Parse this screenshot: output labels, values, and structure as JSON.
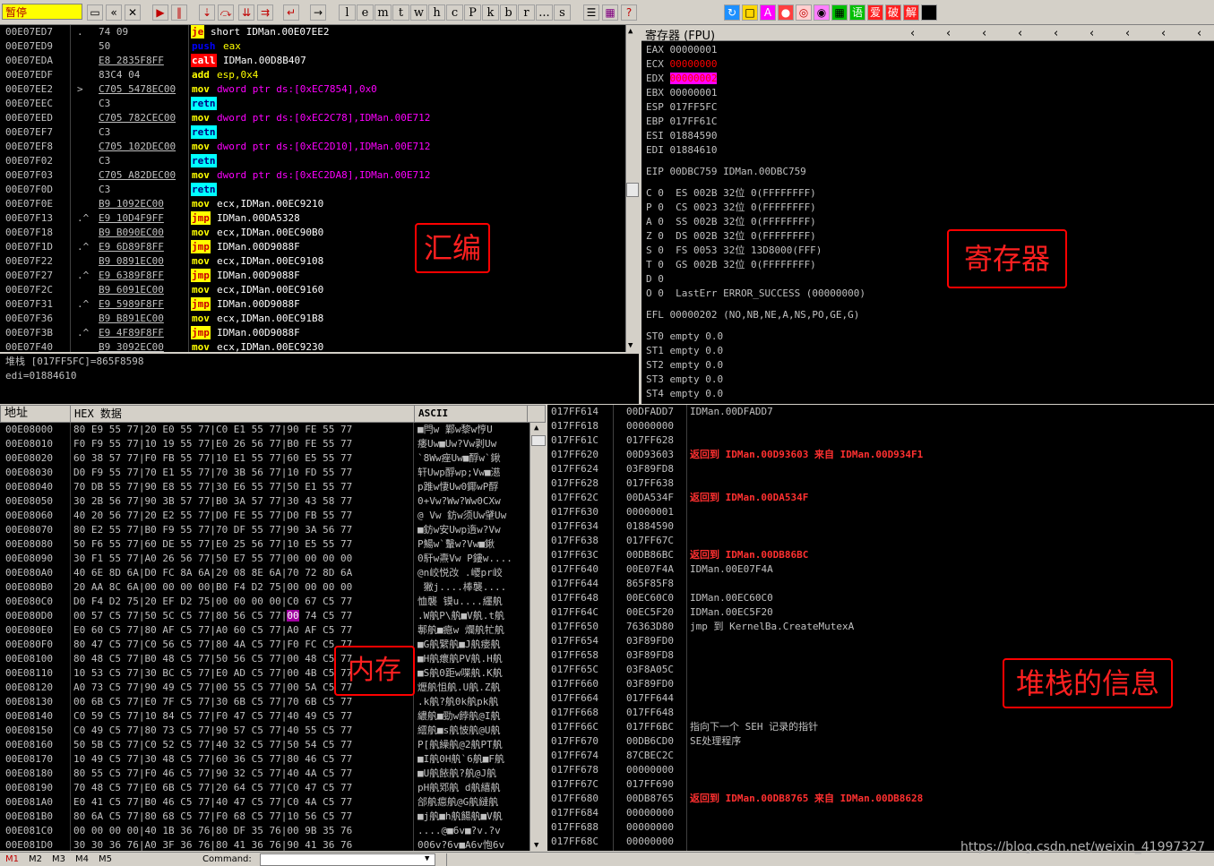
{
  "toolbar": {
    "status": "暂停",
    "letters": [
      "l",
      "e",
      "m",
      "t",
      "w",
      "h",
      "c",
      "P",
      "k",
      "b",
      "r",
      "...",
      "s"
    ],
    "right_icons": [
      "refresh",
      "A",
      "record",
      "target",
      "scope",
      "grid",
      "语",
      "爱",
      "破",
      "解"
    ]
  },
  "cpu": {
    "rows": [
      {
        "addr": "00E07ED7",
        "mark": ".",
        "hex": "74 09",
        "mn": "je",
        "ops": "short IDMan.00E07EE2",
        "mc": "m-je",
        "oc": "ops-w"
      },
      {
        "addr": "00E07ED9",
        "mark": "",
        "hex": "50",
        "mn": "push",
        "ops": "eax",
        "mc": "m-push",
        "oc": "ops-y"
      },
      {
        "addr": "00E07EDA",
        "mark": "",
        "hex": "E8 2835F8FF",
        "mn": "call",
        "ops": "IDMan.00D8B407",
        "mc": "m-call",
        "oc": "ops-w"
      },
      {
        "addr": "00E07EDF",
        "mark": "",
        "hex": "83C4 04",
        "mn": "add",
        "ops": "esp,0x4",
        "mc": "m-add",
        "oc": "ops-y"
      },
      {
        "addr": "00E07EE2",
        "mark": ">",
        "hex": "C705 5478EC00",
        "mn": "mov",
        "ops": "dword ptr ds:[0xEC7854],0x0",
        "mc": "m-mov",
        "oc": "ops-m"
      },
      {
        "addr": "00E07EEC",
        "mark": "",
        "hex": "C3",
        "mn": "retn",
        "ops": "",
        "mc": "m-retn",
        "oc": "ops-w"
      },
      {
        "addr": "00E07EED",
        "mark": "",
        "hex": "C705 782CEC00",
        "mn": "mov",
        "ops": "dword ptr ds:[0xEC2C78],IDMan.00E712",
        "mc": "m-mov",
        "oc": "ops-m"
      },
      {
        "addr": "00E07EF7",
        "mark": "",
        "hex": "C3",
        "mn": "retn",
        "ops": "",
        "mc": "m-retn",
        "oc": "ops-w"
      },
      {
        "addr": "00E07EF8",
        "mark": "",
        "hex": "C705 102DEC00",
        "mn": "mov",
        "ops": "dword ptr ds:[0xEC2D10],IDMan.00E712",
        "mc": "m-mov",
        "oc": "ops-m"
      },
      {
        "addr": "00E07F02",
        "mark": "",
        "hex": "C3",
        "mn": "retn",
        "ops": "",
        "mc": "m-retn",
        "oc": "ops-w"
      },
      {
        "addr": "00E07F03",
        "mark": "",
        "hex": "C705 A82DEC00",
        "mn": "mov",
        "ops": "dword ptr ds:[0xEC2DA8],IDMan.00E712",
        "mc": "m-mov",
        "oc": "ops-m"
      },
      {
        "addr": "00E07F0D",
        "mark": "",
        "hex": "C3",
        "mn": "retn",
        "ops": "",
        "mc": "m-retn",
        "oc": "ops-w"
      },
      {
        "addr": "00E07F0E",
        "mark": "",
        "hex": "B9 1092EC00",
        "mn": "mov",
        "ops": "ecx,IDMan.00EC9210",
        "mc": "m-mov",
        "oc": "ops-w"
      },
      {
        "addr": "00E07F13",
        "mark": ".^",
        "hex": "E9 10D4F9FF",
        "mn": "jmp",
        "ops": "IDMan.00DA5328",
        "mc": "m-jmp",
        "oc": "ops-w"
      },
      {
        "addr": "00E07F18",
        "mark": "",
        "hex": "B9 B090EC00",
        "mn": "mov",
        "ops": "ecx,IDMan.00EC90B0",
        "mc": "m-mov",
        "oc": "ops-w"
      },
      {
        "addr": "00E07F1D",
        "mark": ".^",
        "hex": "E9 6D89F8FF",
        "mn": "jmp",
        "ops": "IDMan.00D9088F",
        "mc": "m-jmp",
        "oc": "ops-w"
      },
      {
        "addr": "00E07F22",
        "mark": "",
        "hex": "B9 0891EC00",
        "mn": "mov",
        "ops": "ecx,IDMan.00EC9108",
        "mc": "m-mov",
        "oc": "ops-w"
      },
      {
        "addr": "00E07F27",
        "mark": ".^",
        "hex": "E9 6389F8FF",
        "mn": "jmp",
        "ops": "IDMan.00D9088F",
        "mc": "m-jmp",
        "oc": "ops-w"
      },
      {
        "addr": "00E07F2C",
        "mark": "",
        "hex": "B9 6091EC00",
        "mn": "mov",
        "ops": "ecx,IDMan.00EC9160",
        "mc": "m-mov",
        "oc": "ops-w"
      },
      {
        "addr": "00E07F31",
        "mark": ".^",
        "hex": "E9 5989F8FF",
        "mn": "jmp",
        "ops": "IDMan.00D9088F",
        "mc": "m-jmp",
        "oc": "ops-w"
      },
      {
        "addr": "00E07F36",
        "mark": "",
        "hex": "B9 B891EC00",
        "mn": "mov",
        "ops": "ecx,IDMan.00EC91B8",
        "mc": "m-mov",
        "oc": "ops-w"
      },
      {
        "addr": "00E07F3B",
        "mark": ".^",
        "hex": "E9 4F89F8FF",
        "mn": "jmp",
        "ops": "IDMan.00D9088F",
        "mc": "m-jmp",
        "oc": "ops-w"
      },
      {
        "addr": "00E07F40",
        "mark": "",
        "hex": "B9 3092EC00",
        "mn": "mov",
        "ops": "ecx,IDMan.00EC9230",
        "mc": "m-mov",
        "oc": "ops-w"
      }
    ]
  },
  "info": {
    "line1": "堆栈 [017FF5FC]=865F8598",
    "line2": "edi=01884610"
  },
  "registers": {
    "title": "寄存器 (FPU)",
    "gp": [
      {
        "name": "EAX",
        "val": "00000001",
        "cls": ""
      },
      {
        "name": "ECX",
        "val": "00000000",
        "cls": "regred"
      },
      {
        "name": "EDX",
        "val": "00000002",
        "cls": "reghl"
      },
      {
        "name": "EBX",
        "val": "00000001",
        "cls": ""
      },
      {
        "name": "ESP",
        "val": "017FF5FC",
        "cls": ""
      },
      {
        "name": "EBP",
        "val": "017FF61C",
        "cls": ""
      },
      {
        "name": "ESI",
        "val": "01884590",
        "cls": ""
      },
      {
        "name": "EDI",
        "val": "01884610",
        "cls": ""
      }
    ],
    "eip": "EIP 00DBC759 IDMan.00DBC759",
    "flags": [
      "C 0  ES 002B 32位 0(FFFFFFFF)",
      "P 0  CS 0023 32位 0(FFFFFFFF)",
      "A 0  SS 002B 32位 0(FFFFFFFF)",
      "Z 0  DS 002B 32位 0(FFFFFFFF)",
      "S 0  FS 0053 32位 13D8000(FFF)",
      "T 0  GS 002B 32位 0(FFFFFFFF)",
      "D 0",
      "O 0  LastErr ERROR_SUCCESS (00000000)"
    ],
    "efl": "EFL 00000202 (NO,NB,NE,A,NS,PO,GE,G)",
    "fpu": [
      "ST0 empty 0.0",
      "ST1 empty 0.0",
      "ST2 empty 0.0",
      "ST3 empty 0.0",
      "ST4 empty 0.0"
    ]
  },
  "dump": {
    "col_addr": "地址",
    "col_hex": "HEX 数据",
    "col_ascii": "ASCII",
    "rows": [
      [
        "00E08000",
        "80 E9 55 77|20 E0 55 77|C0 E1 55 77|90 FE 55 77",
        "■閂w 鄴w黎w悙U"
      ],
      [
        "00E08010",
        "F0 F9 55 77|10 19 55 77|E0 26 56 77|B0 FE 55 77",
        "痿Uw■Uw?Vw剥Uw"
      ],
      [
        "00E08020",
        "60 38 57 77|F0 FB 55 77|10 E1 55 77|60 E5 55 77",
        "`8Ww痤Uw■酻w`鍬"
      ],
      [
        "00E08030",
        "D0 F9 55 77|70 E1 55 77|70 3B 56 77|10 FD 55 77",
        "轩Uwp酻wp;Vw■濨"
      ],
      [
        "00E08040",
        "70 DB 55 77|90 E8 55 77|30 E6 55 77|50 E1 55 77",
        "p踓w悽Uw0鎁wP酻"
      ],
      [
        "00E08050",
        "30 2B 56 77|90 3B 57 77|B0 3A 57 77|30 43 58 77",
        "0+Vw?Ww?Ww0CXw"
      ],
      [
        "00E08060",
        "40 20 56 77|20 E2 55 77|D0 FE 55 77|D0 FB 55 77",
        "@ Vw 鈁w须Uw肈Uw"
      ],
      [
        "00E08070",
        "80 E2 55 77|B0 F9 55 77|70 DF 55 77|90 3A 56 77",
        "■鈁w安Uwp遀w?Vw"
      ],
      [
        "00E08080",
        "50 F6 55 77|60 DE 55 77|E0 25 56 77|10 E5 55 77",
        "P鰑w`轚w?Vw■鍬"
      ],
      [
        "00E08090",
        "30 F1 55 77|A0 26 56 77|50 E7 55 77|00 00 00 00",
        "0馯w燾Vw P鏤w...."
      ],
      [
        "00E080A0",
        "40 6E 8D 6A|D0 FC 8A 6A|20 08 8E 6A|70 72 8D 6A",
        "@n峧悦妀 .巎pr峧"
      ],
      [
        "00E080B0",
        "20 AA 8C 6A|00 00 00 00|B0 F4 D2 75|00 00 00 00",
        " 獙j....棒襲...."
      ],
      [
        "00E080C0",
        "D0 F4 D2 75|20 EF D2 75|00 00 00 00|C0 67 C5 77",
        "恤襲 镆u....纆舧"
      ],
      [
        "00E080D0",
        "00 57 C5 77|50 5C C5 77|80 56 C5 77|00 74 C5 77",
        ".W舧P\\舧■V舧.t舧"
      ],
      [
        "00E080E0",
        "E0 60 C5 77|80 AF C5 77|A0 60 C5 77|A0 AF C5 77",
        "鄟舧■瘜w 爛舧牤舧"
      ],
      [
        "00E080F0",
        "80 47 C5 77|C0 56 C5 77|80 4A C5 77|F0 FC C5 77",
        "■G舧繴舧■J舧瘘舧"
      ],
      [
        "00E08100",
        "80 48 C5 77|B0 48 C5 77|50 56 C5 77|00 48 C5 77",
        "■H舧癏舧PV舧.H舧"
      ],
      [
        "00E08110",
        "10 53 C5 77|30 BC C5 77|E0 AD C5 77|00 4B C5 77",
        "■S舧0距w喋舧.K舧"
      ],
      [
        "00E08120",
        "A0 73 C5 77|90 49 C5 77|00 55 C5 77|00 5A C5 77",
        "爏舧怚舧.U舧.Z舧"
      ],
      [
        "00E08130",
        "00 6B C5 77|E0 7F C5 77|30 6B C5 77|70 6B C5 77",
        ".k舧?舧0k舧pk舧"
      ],
      [
        "00E08140",
        "C0 59 C5 77|10 84 C5 77|F0 47 C5 77|40 49 C5 77",
        "繷舧■勁w餑舧@I舧"
      ],
      [
        "00E08150",
        "C0 49 C5 77|80 73 C5 77|90 57 C5 77|40 55 C5 77",
        "繧舧■s舧怶舧@U舧"
      ],
      [
        "00E08160",
        "50 5B C5 77|C0 52 C5 77|40 32 C5 77|50 54 C5 77",
        "P[舧繰舧@2舧PT舧"
      ],
      [
        "00E08170",
        "10 49 C5 77|30 48 C5 77|60 36 C5 77|80 46 C5 77",
        "■I舧0H舧`6舧■F舧"
      ],
      [
        "00E08180",
        "80 55 C5 77|F0 46 C5 77|90 32 C5 77|40 4A C5 77",
        "■U舧餏舧?舧@J舧"
      ],
      [
        "00E08190",
        "70 48 C5 77|E0 6B C5 77|20 64 C5 77|C0 47 C5 77",
        "pH舧鄈舧 d舧繥舧"
      ],
      [
        "00E081A0",
        "E0 41 C5 77|B0 46 C5 77|40 47 C5 77|C0 4A C5 77",
        "郃舧癋舧@G舧繨舧"
      ],
      [
        "00E081B0",
        "80 6A C5 77|80 68 C5 77|F0 68 C5 77|10 56 C5 77",
        "■j舧■h舧餳舧■V舧"
      ],
      [
        "00E081C0",
        "00 00 00 00|40 1B 36 76|80 DF 35 76|00 9B 35 76",
        "....@■6v■?v.?v"
      ],
      [
        "00E081D0",
        "30 30 36 76|A0 3F 36 76|80 41 36 76|90 41 36 76",
        "006v?6v■A6v怉6v"
      ]
    ]
  },
  "stack": {
    "rows": [
      [
        "017FF614",
        "00DFADD7",
        "IDMan.00DFADD7",
        ""
      ],
      [
        "017FF618",
        "00000000",
        "",
        ""
      ],
      [
        "017FF61C",
        "017FF628",
        "",
        ""
      ],
      [
        "017FF620",
        "00D93603",
        "返回到 IDMan.00D93603 来自 IDMan.00D934F1",
        "red"
      ],
      [
        "017FF624",
        "03F89FD8",
        "",
        ""
      ],
      [
        "017FF628",
        "017FF638",
        "",
        ""
      ],
      [
        "017FF62C",
        "00DA534F",
        "返回到 IDMan.00DA534F",
        "red"
      ],
      [
        "017FF630",
        "00000001",
        "",
        ""
      ],
      [
        "017FF634",
        "01884590",
        "",
        ""
      ],
      [
        "017FF638",
        "017FF67C",
        "",
        ""
      ],
      [
        "017FF63C",
        "00DB86BC",
        "返回到 IDMan.00DB86BC",
        "red"
      ],
      [
        "017FF640",
        "00E07F4A",
        "IDMan.00E07F4A",
        ""
      ],
      [
        "017FF644",
        "865F85F8",
        "",
        ""
      ],
      [
        "017FF648",
        "00EC60C0",
        "IDMan.00EC60C0",
        ""
      ],
      [
        "017FF64C",
        "00EC5F20",
        "IDMan.00EC5F20",
        ""
      ],
      [
        "017FF650",
        "76363D80",
        "jmp 到 KernelBa.CreateMutexA",
        ""
      ],
      [
        "017FF654",
        "03F89FD0",
        "",
        ""
      ],
      [
        "017FF658",
        "03F89FD8",
        "",
        ""
      ],
      [
        "017FF65C",
        "03F8A05C",
        "",
        ""
      ],
      [
        "017FF660",
        "03F89FD0",
        "",
        ""
      ],
      [
        "017FF664",
        "017FF644",
        "",
        ""
      ],
      [
        "017FF668",
        "017FF648",
        "",
        ""
      ],
      [
        "017FF66C",
        "017FF6BC",
        "指向下一个 SEH 记录的指针",
        ""
      ],
      [
        "017FF670",
        "00DB6CD0",
        "SE处理程序",
        ""
      ],
      [
        "017FF674",
        "87CBEC2C",
        "",
        ""
      ],
      [
        "017FF678",
        "00000000",
        "",
        ""
      ],
      [
        "017FF67C",
        "017FF690",
        "",
        ""
      ],
      [
        "017FF680",
        "00DB8765",
        "返回到 IDMan.00DB8765 来自 IDMan.00DB8628",
        "red"
      ],
      [
        "017FF684",
        "00000000",
        "",
        ""
      ],
      [
        "017FF688",
        "00000000",
        "",
        ""
      ],
      [
        "017FF68C",
        "00000000",
        "",
        ""
      ]
    ]
  },
  "annotations": {
    "asm": "汇编",
    "regs": "寄存器",
    "mem": "内存",
    "stack": "堆栈的信息"
  },
  "bottom": {
    "tabs": [
      "M1",
      "M2",
      "M3",
      "M4",
      "M5"
    ],
    "command_label": "Command:",
    "watermark": "https://blog.csdn.net/weixin_41997327"
  }
}
